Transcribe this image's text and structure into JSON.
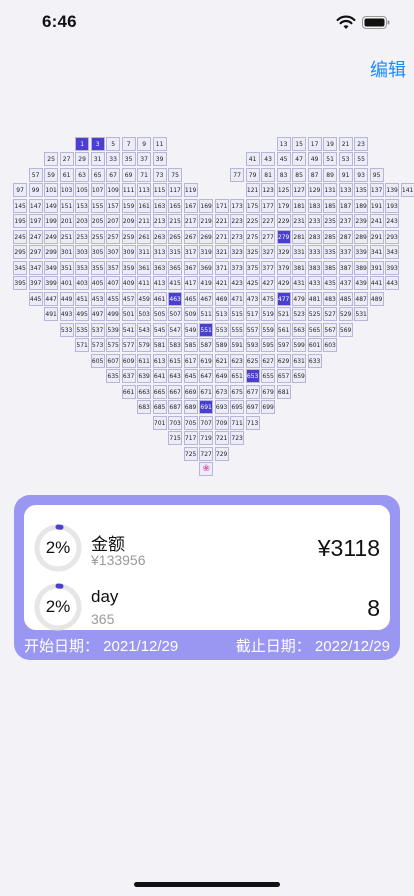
{
  "status_bar": {
    "time": "6:46"
  },
  "nav": {
    "edit_label": "编辑"
  },
  "grid": {
    "filled": [
      1,
      3,
      279,
      463,
      477,
      551,
      653,
      691
    ],
    "rows": [
      {
        "start": 1,
        "end": 11,
        "col0": 4
      },
      {
        "start": 13,
        "end": 23,
        "col0": 17
      },
      {
        "start": 25,
        "end": 39,
        "col0": 2
      },
      {
        "start": 41,
        "end": 55,
        "col0": 15
      },
      {
        "start": 57,
        "end": 75,
        "col0": 1
      },
      {
        "start": 77,
        "end": 95,
        "col0": 14
      },
      {
        "start": 97,
        "end": 119,
        "col0": 0
      },
      {
        "start": 121,
        "end": 143,
        "col0": 15
      },
      {
        "start": 145,
        "end": 169,
        "col0": 0
      },
      {
        "start": 171,
        "end": 193,
        "col0": 13
      },
      {
        "start": 195,
        "end": 219,
        "col0": 0
      },
      {
        "start": 221,
        "end": 243,
        "col0": 13
      },
      {
        "start": 245,
        "end": 269,
        "col0": 0
      },
      {
        "start": 271,
        "end": 293,
        "col0": 13
      },
      {
        "start": 295,
        "end": 319,
        "col0": 0
      },
      {
        "start": 321,
        "end": 343,
        "col0": 13
      },
      {
        "start": 345,
        "end": 369,
        "col0": 0
      },
      {
        "start": 371,
        "end": 393,
        "col0": 13
      },
      {
        "start": 395,
        "end": 419,
        "col0": 0
      },
      {
        "start": 421,
        "end": 443,
        "col0": 13
      },
      {
        "start": 445,
        "end": 489,
        "col0": 1
      },
      {
        "start": 491,
        "end": 531,
        "col0": 2
      },
      {
        "start": 533,
        "end": 569,
        "col0": 3
      },
      {
        "start": 571,
        "end": 603,
        "col0": 4
      },
      {
        "start": 605,
        "end": 633,
        "col0": 5
      },
      {
        "start": 635,
        "end": 659,
        "col0": 6
      },
      {
        "start": 661,
        "end": 681,
        "col0": 7
      },
      {
        "start": 683,
        "end": 699,
        "col0": 8
      },
      {
        "start": 701,
        "end": 713,
        "col0": 9
      },
      {
        "start": 715,
        "end": 723,
        "col0": 10
      },
      {
        "start": 725,
        "end": 729,
        "col0": 11
      }
    ],
    "heart_symbol": "❀"
  },
  "summary": {
    "amount": {
      "percent_label": "2%",
      "progress": 0.023,
      "title": "金额",
      "subtitle": "¥133956",
      "value": "¥3118"
    },
    "day": {
      "percent_label": "2%",
      "progress": 0.022,
      "title": "day",
      "subtitle": "365",
      "value": "8"
    },
    "start_date_label": "开始日期： 2021/12/29",
    "end_date_label": "截止日期： 2022/12/29"
  },
  "colors": {
    "accent": "#4a3fcf",
    "card_bg": "#9a97f2",
    "link": "#1a8cff",
    "ring_track": "#e6e6e6",
    "ring_fill": "#4a3fcf"
  },
  "icons": [
    "wifi-icon",
    "battery-icon",
    "flower-icon"
  ]
}
